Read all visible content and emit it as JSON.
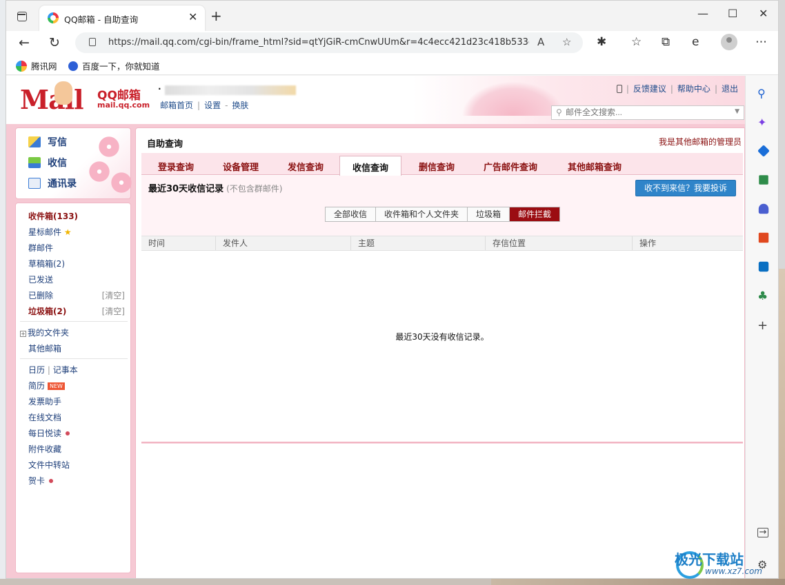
{
  "browser": {
    "tab_title": "QQ邮箱 - 自助查询",
    "url": "https://mail.qq.com/cgi-bin/frame_html?sid=qtYjGiR-cmCnwUUm&r=4c4ecc421d23c418b533cb...",
    "bookmarks": [
      "腾讯网",
      "百度一下，你就知道"
    ]
  },
  "header": {
    "logo_text": "Mail",
    "brand_qq": "QQ邮箱",
    "brand_url": "mail.qq.com",
    "user_dot": "·",
    "links": [
      "邮箱首页",
      "设置",
      "换肤"
    ],
    "top_links": [
      "反馈建议",
      "帮助中心",
      "退出"
    ],
    "search_placeholder": "邮件全文搜索..."
  },
  "sidebar": {
    "actions": [
      "写信",
      "收信",
      "通讯录"
    ],
    "folders": [
      {
        "label": "收件箱",
        "count": "(133)"
      },
      {
        "label": "星标邮件"
      },
      {
        "label": "群邮件"
      },
      {
        "label": "草稿箱(2)"
      },
      {
        "label": "已发送"
      },
      {
        "label": "已删除",
        "action": "[清空]"
      },
      {
        "label": "垃圾箱",
        "count": "(2)",
        "action": "[清空]"
      }
    ],
    "my_folders": "我的文件夹",
    "other_mailbox": "其他邮箱",
    "tools": {
      "calendar": "日历",
      "notebook": "记事本",
      "resume": "简历",
      "new_badge": "NEW",
      "invoice": "发票助手",
      "online_docs": "在线文档",
      "daily_read": "每日悦读",
      "attachments": "附件收藏",
      "file_transfer": "文件中转站",
      "greeting_card": "贺卡"
    }
  },
  "content": {
    "breadcrumb": "自助查询",
    "admin_link": "我是其他邮箱的管理员",
    "tabs": [
      "登录查询",
      "设备管理",
      "发信查询",
      "收信查询",
      "删信查询",
      "广告邮件查询",
      "其他邮箱查询"
    ],
    "active_tab": "收信查询",
    "panel_title": "最近30天收信记录",
    "panel_note": "(不包含群邮件)",
    "complain_button": "收不到来信？我要投诉",
    "filters": [
      "全部收信",
      "收件箱和个人文件夹",
      "垃圾箱",
      "邮件拦截"
    ],
    "active_filter": "邮件拦截",
    "columns": [
      "时间",
      "发件人",
      "主题",
      "存信位置",
      "操作"
    ],
    "empty_message": "最近30天没有收信记录。"
  },
  "watermark": {
    "name": "极光下载站",
    "url": "www.xz7.com"
  },
  "colors": {
    "brand_red": "#c9202a",
    "tab_text": "#8a1010",
    "active_filter_bg": "#9b0d12",
    "complain_bg": "#2f84c9",
    "theme_pink": "#f6c9d4"
  }
}
